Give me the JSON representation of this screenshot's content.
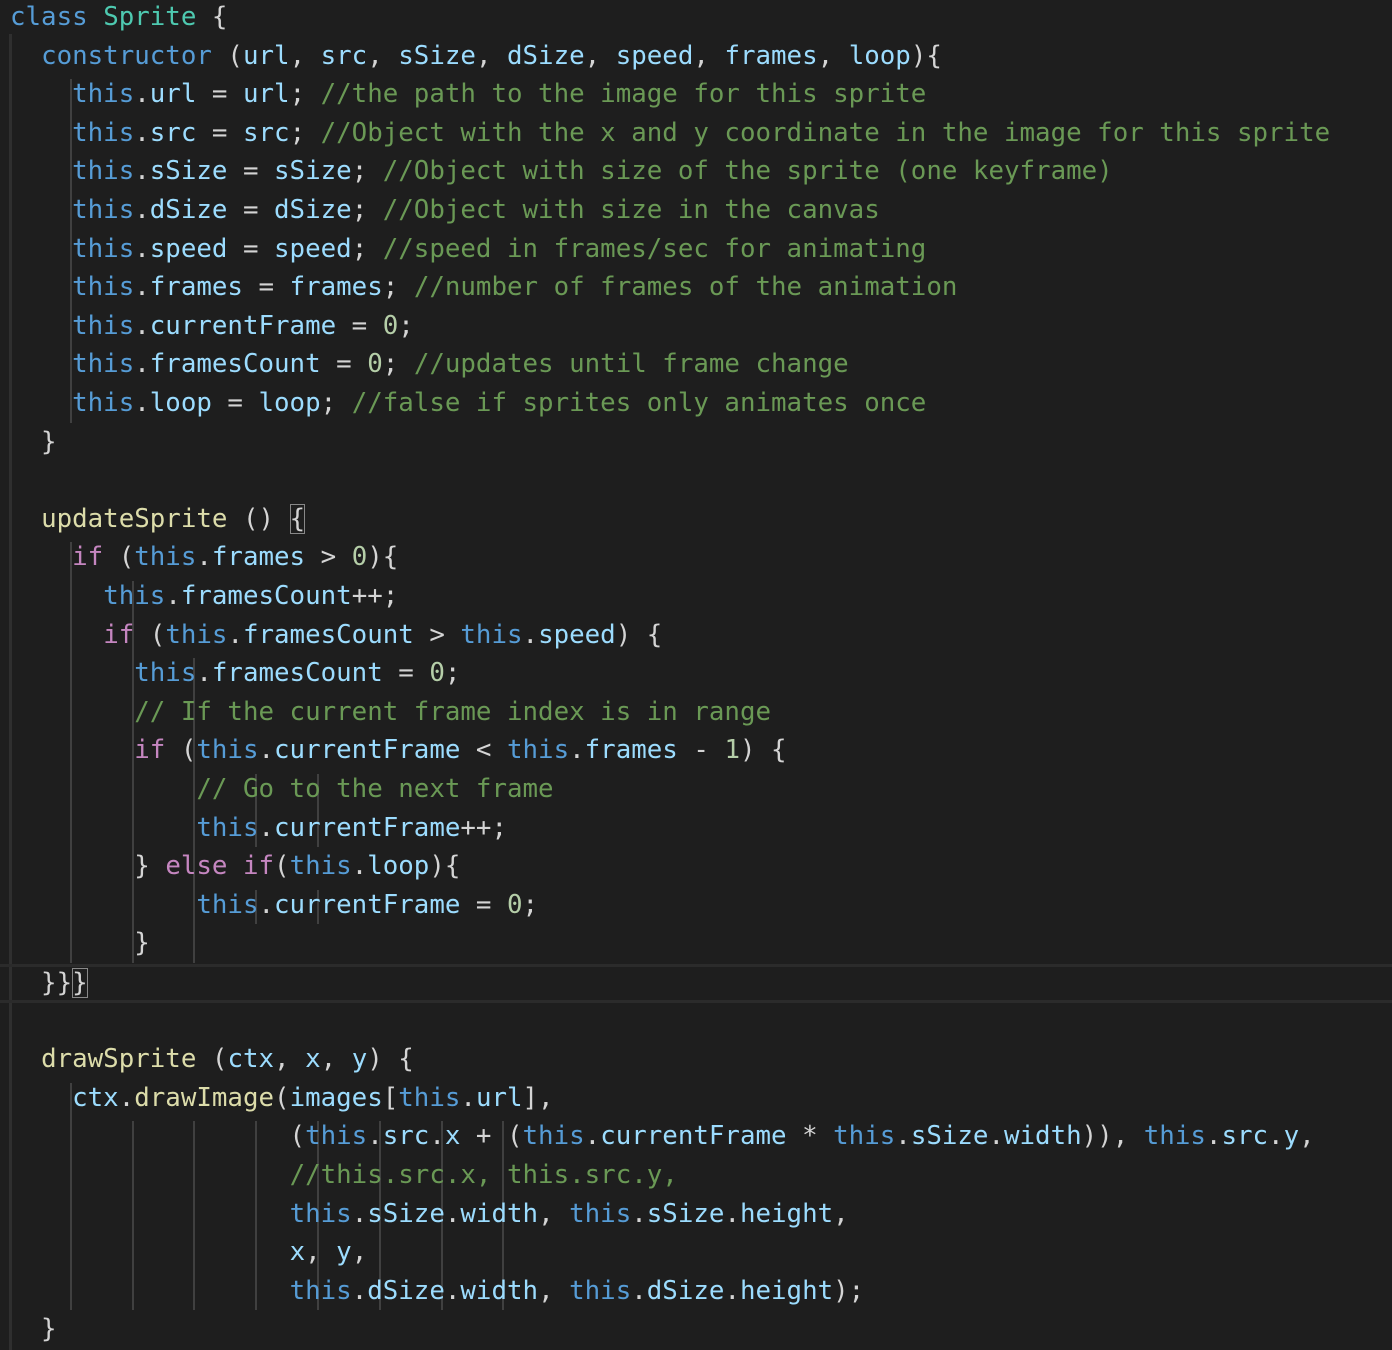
{
  "colors": {
    "background": "#1e1e1e",
    "keyword": "#569cd6",
    "class_name": "#4ec9b0",
    "function": "#dcdcaa",
    "variable": "#9cdcfe",
    "comment": "#6a9955",
    "control": "#c586c0",
    "number": "#b5cea8",
    "punctuation": "#d4d4d4"
  },
  "code": {
    "lines": [
      [
        [
          "class",
          "kw"
        ],
        [
          " ",
          "pl"
        ],
        [
          "Sprite",
          "cls"
        ],
        [
          " {",
          "pl"
        ]
      ],
      [
        [
          "  ",
          "pl"
        ],
        [
          "constructor",
          "kw"
        ],
        [
          " (",
          "pl"
        ],
        [
          "url",
          "var"
        ],
        [
          ", ",
          "pl"
        ],
        [
          "src",
          "var"
        ],
        [
          ", ",
          "pl"
        ],
        [
          "sSize",
          "var"
        ],
        [
          ", ",
          "pl"
        ],
        [
          "dSize",
          "var"
        ],
        [
          ", ",
          "pl"
        ],
        [
          "speed",
          "var"
        ],
        [
          ", ",
          "pl"
        ],
        [
          "frames",
          "var"
        ],
        [
          ", ",
          "pl"
        ],
        [
          "loop",
          "var"
        ],
        [
          "){",
          "pl"
        ]
      ],
      [
        [
          "    ",
          "pl"
        ],
        [
          "this",
          "th"
        ],
        [
          ".",
          "pl"
        ],
        [
          "url",
          "var"
        ],
        [
          " = ",
          "pl"
        ],
        [
          "url",
          "var"
        ],
        [
          "; ",
          "pl"
        ],
        [
          "//the path to the image for this sprite",
          "cm"
        ]
      ],
      [
        [
          "    ",
          "pl"
        ],
        [
          "this",
          "th"
        ],
        [
          ".",
          "pl"
        ],
        [
          "src",
          "var"
        ],
        [
          " = ",
          "pl"
        ],
        [
          "src",
          "var"
        ],
        [
          "; ",
          "pl"
        ],
        [
          "//Object with the x and y coordinate in the image for this sprite",
          "cm"
        ]
      ],
      [
        [
          "    ",
          "pl"
        ],
        [
          "this",
          "th"
        ],
        [
          ".",
          "pl"
        ],
        [
          "sSize",
          "var"
        ],
        [
          " = ",
          "pl"
        ],
        [
          "sSize",
          "var"
        ],
        [
          "; ",
          "pl"
        ],
        [
          "//Object with size of the sprite (one keyframe)",
          "cm"
        ]
      ],
      [
        [
          "    ",
          "pl"
        ],
        [
          "this",
          "th"
        ],
        [
          ".",
          "pl"
        ],
        [
          "dSize",
          "var"
        ],
        [
          " = ",
          "pl"
        ],
        [
          "dSize",
          "var"
        ],
        [
          "; ",
          "pl"
        ],
        [
          "//Object with size in the canvas",
          "cm"
        ]
      ],
      [
        [
          "    ",
          "pl"
        ],
        [
          "this",
          "th"
        ],
        [
          ".",
          "pl"
        ],
        [
          "speed",
          "var"
        ],
        [
          " = ",
          "pl"
        ],
        [
          "speed",
          "var"
        ],
        [
          "; ",
          "pl"
        ],
        [
          "//speed in frames/sec for animating",
          "cm"
        ]
      ],
      [
        [
          "    ",
          "pl"
        ],
        [
          "this",
          "th"
        ],
        [
          ".",
          "pl"
        ],
        [
          "frames",
          "var"
        ],
        [
          " = ",
          "pl"
        ],
        [
          "frames",
          "var"
        ],
        [
          "; ",
          "pl"
        ],
        [
          "//number of frames of the animation",
          "cm"
        ]
      ],
      [
        [
          "    ",
          "pl"
        ],
        [
          "this",
          "th"
        ],
        [
          ".",
          "pl"
        ],
        [
          "currentFrame",
          "var"
        ],
        [
          " = ",
          "pl"
        ],
        [
          "0",
          "num"
        ],
        [
          ";",
          "pl"
        ]
      ],
      [
        [
          "    ",
          "pl"
        ],
        [
          "this",
          "th"
        ],
        [
          ".",
          "pl"
        ],
        [
          "framesCount",
          "var"
        ],
        [
          " = ",
          "pl"
        ],
        [
          "0",
          "num"
        ],
        [
          "; ",
          "pl"
        ],
        [
          "//updates until frame change",
          "cm"
        ]
      ],
      [
        [
          "    ",
          "pl"
        ],
        [
          "this",
          "th"
        ],
        [
          ".",
          "pl"
        ],
        [
          "loop",
          "var"
        ],
        [
          " = ",
          "pl"
        ],
        [
          "loop",
          "var"
        ],
        [
          "; ",
          "pl"
        ],
        [
          "//false if sprites only animates once",
          "cm"
        ]
      ],
      [
        [
          "  }",
          "pl"
        ]
      ],
      [],
      [
        [
          "  ",
          "pl"
        ],
        [
          "updateSprite",
          "fn"
        ],
        [
          " () ",
          "pl"
        ],
        [
          "{",
          "pl br-match"
        ]
      ],
      [
        [
          "    ",
          "pl"
        ],
        [
          "if",
          "cf"
        ],
        [
          " (",
          "pl"
        ],
        [
          "this",
          "th"
        ],
        [
          ".",
          "pl"
        ],
        [
          "frames",
          "var"
        ],
        [
          " > ",
          "pl"
        ],
        [
          "0",
          "num"
        ],
        [
          "){",
          "pl"
        ]
      ],
      [
        [
          "      ",
          "pl"
        ],
        [
          "this",
          "th"
        ],
        [
          ".",
          "pl"
        ],
        [
          "framesCount",
          "var"
        ],
        [
          "++;",
          "pl"
        ]
      ],
      [
        [
          "      ",
          "pl"
        ],
        [
          "if",
          "cf"
        ],
        [
          " (",
          "pl"
        ],
        [
          "this",
          "th"
        ],
        [
          ".",
          "pl"
        ],
        [
          "framesCount",
          "var"
        ],
        [
          " > ",
          "pl"
        ],
        [
          "this",
          "th"
        ],
        [
          ".",
          "pl"
        ],
        [
          "speed",
          "var"
        ],
        [
          ") {",
          "pl"
        ]
      ],
      [
        [
          "        ",
          "pl"
        ],
        [
          "this",
          "th"
        ],
        [
          ".",
          "pl"
        ],
        [
          "framesCount",
          "var"
        ],
        [
          " = ",
          "pl"
        ],
        [
          "0",
          "num"
        ],
        [
          ";",
          "pl"
        ]
      ],
      [
        [
          "        ",
          "pl"
        ],
        [
          "// If the current frame index is in range",
          "cm"
        ]
      ],
      [
        [
          "        ",
          "pl"
        ],
        [
          "if",
          "cf"
        ],
        [
          " (",
          "pl"
        ],
        [
          "this",
          "th"
        ],
        [
          ".",
          "pl"
        ],
        [
          "currentFrame",
          "var"
        ],
        [
          " < ",
          "pl"
        ],
        [
          "this",
          "th"
        ],
        [
          ".",
          "pl"
        ],
        [
          "frames",
          "var"
        ],
        [
          " - ",
          "pl"
        ],
        [
          "1",
          "num"
        ],
        [
          ") {",
          "pl"
        ]
      ],
      [
        [
          "            ",
          "pl"
        ],
        [
          "// Go to the next frame",
          "cm"
        ]
      ],
      [
        [
          "            ",
          "pl"
        ],
        [
          "this",
          "th"
        ],
        [
          ".",
          "pl"
        ],
        [
          "currentFrame",
          "var"
        ],
        [
          "++;",
          "pl"
        ]
      ],
      [
        [
          "        } ",
          "pl"
        ],
        [
          "else",
          "cf"
        ],
        [
          " ",
          "pl"
        ],
        [
          "if",
          "cf"
        ],
        [
          "(",
          "pl"
        ],
        [
          "this",
          "th"
        ],
        [
          ".",
          "pl"
        ],
        [
          "loop",
          "var"
        ],
        [
          "){",
          "pl"
        ]
      ],
      [
        [
          "            ",
          "pl"
        ],
        [
          "this",
          "th"
        ],
        [
          ".",
          "pl"
        ],
        [
          "currentFrame",
          "var"
        ],
        [
          " = ",
          "pl"
        ],
        [
          "0",
          "num"
        ],
        [
          ";",
          "pl"
        ]
      ],
      [
        [
          "        }",
          "pl"
        ]
      ],
      [
        [
          "  }}",
          "pl"
        ],
        [
          "}",
          "pl br-match"
        ]
      ],
      [],
      [
        [
          "  ",
          "pl"
        ],
        [
          "drawSprite",
          "fn"
        ],
        [
          " (",
          "pl"
        ],
        [
          "ctx",
          "var"
        ],
        [
          ", ",
          "pl"
        ],
        [
          "x",
          "var"
        ],
        [
          ", ",
          "pl"
        ],
        [
          "y",
          "var"
        ],
        [
          ") {",
          "pl"
        ]
      ],
      [
        [
          "    ",
          "pl"
        ],
        [
          "ctx",
          "var"
        ],
        [
          ".",
          "pl"
        ],
        [
          "drawImage",
          "fn"
        ],
        [
          "(",
          "pl"
        ],
        [
          "images",
          "var"
        ],
        [
          "[",
          "pl"
        ],
        [
          "this",
          "th"
        ],
        [
          ".",
          "pl"
        ],
        [
          "url",
          "var"
        ],
        [
          "],",
          "pl"
        ]
      ],
      [
        [
          "                  (",
          "pl"
        ],
        [
          "this",
          "th"
        ],
        [
          ".",
          "pl"
        ],
        [
          "src",
          "var"
        ],
        [
          ".",
          "pl"
        ],
        [
          "x",
          "var"
        ],
        [
          " + (",
          "pl"
        ],
        [
          "this",
          "th"
        ],
        [
          ".",
          "pl"
        ],
        [
          "currentFrame",
          "var"
        ],
        [
          " * ",
          "pl"
        ],
        [
          "this",
          "th"
        ],
        [
          ".",
          "pl"
        ],
        [
          "sSize",
          "var"
        ],
        [
          ".",
          "pl"
        ],
        [
          "width",
          "var"
        ],
        [
          ")), ",
          "pl"
        ],
        [
          "this",
          "th"
        ],
        [
          ".",
          "pl"
        ],
        [
          "src",
          "var"
        ],
        [
          ".",
          "pl"
        ],
        [
          "y",
          "var"
        ],
        [
          ",",
          "pl"
        ]
      ],
      [
        [
          "                  ",
          "pl"
        ],
        [
          "//this.src.x, this.src.y,",
          "cm"
        ]
      ],
      [
        [
          "                  ",
          "pl"
        ],
        [
          "this",
          "th"
        ],
        [
          ".",
          "pl"
        ],
        [
          "sSize",
          "var"
        ],
        [
          ".",
          "pl"
        ],
        [
          "width",
          "var"
        ],
        [
          ", ",
          "pl"
        ],
        [
          "this",
          "th"
        ],
        [
          ".",
          "pl"
        ],
        [
          "sSize",
          "var"
        ],
        [
          ".",
          "pl"
        ],
        [
          "height",
          "var"
        ],
        [
          ",",
          "pl"
        ]
      ],
      [
        [
          "                  ",
          "pl"
        ],
        [
          "x",
          "var"
        ],
        [
          ", ",
          "pl"
        ],
        [
          "y",
          "var"
        ],
        [
          ",",
          "pl"
        ]
      ],
      [
        [
          "                  ",
          "pl"
        ],
        [
          "this",
          "th"
        ],
        [
          ".",
          "pl"
        ],
        [
          "dSize",
          "var"
        ],
        [
          ".",
          "pl"
        ],
        [
          "width",
          "var"
        ],
        [
          ", ",
          "pl"
        ],
        [
          "this",
          "th"
        ],
        [
          ".",
          "pl"
        ],
        [
          "dSize",
          "var"
        ],
        [
          ".",
          "pl"
        ],
        [
          "height",
          "var"
        ],
        [
          ");",
          "pl"
        ]
      ],
      [
        [
          "  }",
          "pl"
        ]
      ]
    ]
  }
}
